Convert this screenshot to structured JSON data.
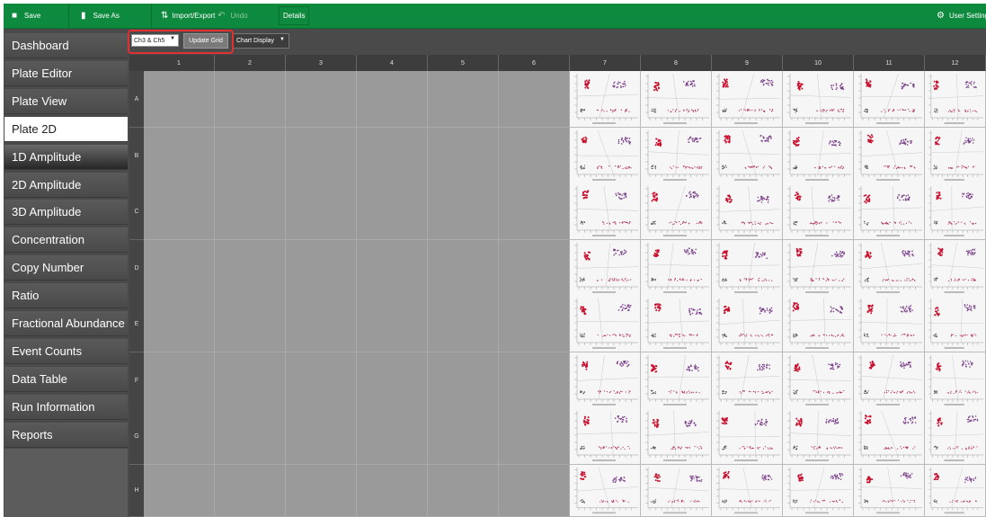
{
  "toolbar": {
    "save_label": "Save",
    "save_as_label": "Save As",
    "import_export_label": "Import/Export",
    "undo_label": "Undo",
    "details_label": "Details",
    "user_settings_label": "User Settings"
  },
  "sidebar": {
    "items": [
      {
        "label": "Dashboard",
        "state": "normal"
      },
      {
        "label": "Plate Editor",
        "state": "normal"
      },
      {
        "label": "Plate View",
        "state": "normal"
      },
      {
        "label": "Plate 2D",
        "state": "active"
      },
      {
        "label": "1D Amplitude",
        "state": "hover"
      },
      {
        "label": "2D Amplitude",
        "state": "normal"
      },
      {
        "label": "3D Amplitude",
        "state": "normal"
      },
      {
        "label": "Concentration",
        "state": "normal"
      },
      {
        "label": "Copy Number",
        "state": "normal"
      },
      {
        "label": "Ratio",
        "state": "normal"
      },
      {
        "label": "Fractional Abundance",
        "state": "normal"
      },
      {
        "label": "Event Counts",
        "state": "normal"
      },
      {
        "label": "Data Table",
        "state": "normal"
      },
      {
        "label": "Run Information",
        "state": "normal"
      },
      {
        "label": "Reports",
        "state": "normal"
      }
    ]
  },
  "controls": {
    "channel_select": "Ch3 & Ch5",
    "update_grid_label": "Update Grid",
    "chart_display_label": "Chart Display"
  },
  "grid": {
    "columns": [
      "1",
      "2",
      "3",
      "4",
      "5",
      "6",
      "7",
      "8",
      "9",
      "10",
      "11",
      "12"
    ],
    "rows": [
      "A",
      "B",
      "C",
      "D",
      "E",
      "F",
      "G",
      "H"
    ],
    "populated_columns": [
      "7",
      "8",
      "9",
      "10",
      "11",
      "12"
    ]
  },
  "colors": {
    "toolbar_green": "#0e8a3e",
    "cluster_red": "#c8102e",
    "cluster_purple": "#7b3f8a",
    "cluster_pink": "#b03060",
    "cluster_gray": "#555555"
  }
}
